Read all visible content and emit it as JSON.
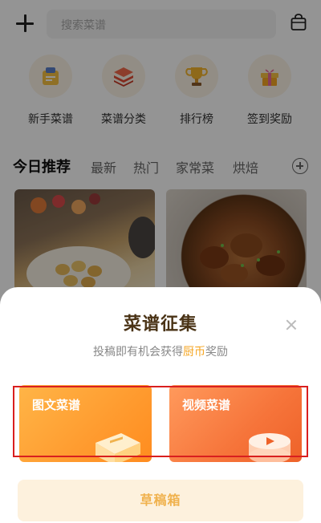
{
  "search": {
    "placeholder": "搜索菜谱"
  },
  "quick_links": [
    {
      "label": "新手菜谱",
      "icon": "beginner-recipe-icon"
    },
    {
      "label": "菜谱分类",
      "icon": "category-icon"
    },
    {
      "label": "排行榜",
      "icon": "trophy-icon"
    },
    {
      "label": "签到奖励",
      "icon": "gift-icon"
    }
  ],
  "tabs": [
    "今日推荐",
    "最新",
    "热门",
    "家常菜",
    "烘焙"
  ],
  "sheet": {
    "title": "菜谱征集",
    "subtitle_prefix": "投稿即有机会获得",
    "subtitle_highlight": "厨币",
    "subtitle_suffix": "奖励",
    "option_image_text": "图文菜谱",
    "option_video": "视频菜谱",
    "draft_button": "草稿箱"
  },
  "colors": {
    "accent": "#f5a623",
    "title_brown": "#4a3316",
    "highlight_frame": "#d91f1f"
  }
}
